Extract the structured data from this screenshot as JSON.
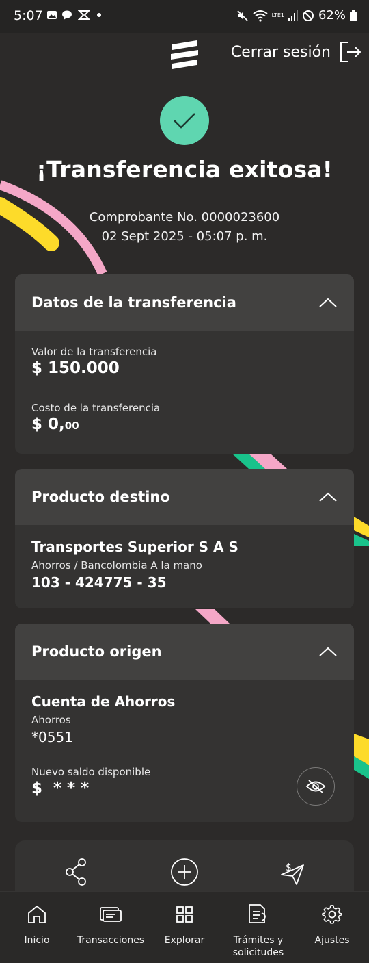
{
  "status_bar": {
    "time": "5:07",
    "battery": "62%",
    "network": "LTE1"
  },
  "header": {
    "logout_label": "Cerrar sesión"
  },
  "result": {
    "title": "¡Transferencia exitosa!",
    "voucher": "Comprobante No. 0000023600",
    "datetime": "02 Sept 2025 - 05:07 p. m."
  },
  "transfer_card": {
    "title": "Datos de la transferencia",
    "value_label": "Valor de la transferencia",
    "value": "$ 150.000",
    "cost_label": "Costo de la transferencia",
    "cost_main": "$ 0,",
    "cost_cents": "00"
  },
  "destination_card": {
    "title": "Producto destino",
    "name": "Transportes Superior S A S",
    "type": "Ahorros / Bancolombia A la mano",
    "account": "103 - 424775 - 35"
  },
  "origin_card": {
    "title": "Producto origen",
    "name": "Cuenta de Ahorros",
    "type": "Ahorros",
    "account": "*0551",
    "balance_label": "Nuevo saldo disponible",
    "balance_masked": "$  * * *"
  },
  "actions": [
    "share-icon",
    "plus-circle-icon",
    "send-money-icon"
  ],
  "bottom_nav": [
    {
      "label": "Inicio",
      "icon": "home-icon"
    },
    {
      "label": "Transacciones",
      "icon": "transactions-icon"
    },
    {
      "label": "Explorar",
      "icon": "grid-icon"
    },
    {
      "label": "Trámites y solicitudes",
      "icon": "documents-icon"
    },
    {
      "label": "Ajustes",
      "icon": "gear-icon"
    }
  ],
  "colors": {
    "background": "#2c2a29",
    "success": "#5fd6b0",
    "pink": "#f4a7c7",
    "yellow": "#fddb2a",
    "green": "#19c38b"
  }
}
